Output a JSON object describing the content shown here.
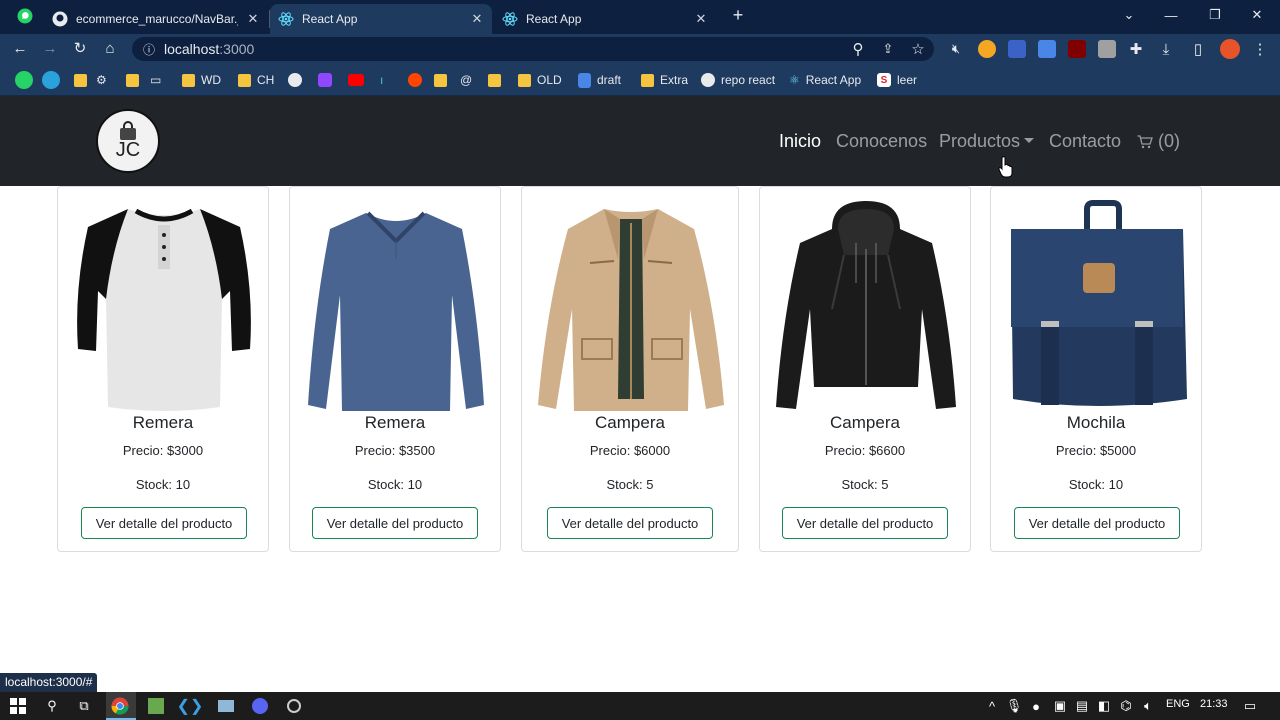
{
  "browser": {
    "tabs": [
      {
        "title": "ecommerce_marucco/NavBar.js a",
        "icon": "github-icon"
      },
      {
        "title": "React App",
        "icon": "react-icon"
      },
      {
        "title": "React App",
        "icon": "react-icon"
      }
    ],
    "url_host": "localhost",
    "url_port": ":3000",
    "bookmarks": [
      "WD",
      "CH",
      "OLD",
      "draft",
      "Extra",
      "repo react",
      "React App",
      "leer"
    ]
  },
  "navbar": {
    "logo_text": "JC",
    "links": {
      "inicio": "Inicio",
      "conocenos": "Conocenos",
      "productos": "Productos",
      "contacto": "Contacto"
    },
    "cart_count": "(0)"
  },
  "products": [
    {
      "name": "Remera",
      "price": "Precio: $3000",
      "stock": "Stock: 10",
      "button": "Ver detalle del producto",
      "image": "raglan-tshirt"
    },
    {
      "name": "Remera",
      "price": "Precio: $3500",
      "stock": "Stock: 10",
      "button": "Ver detalle del producto",
      "image": "blue-longsleeve"
    },
    {
      "name": "Campera",
      "price": "Precio: $6000",
      "stock": "Stock: 5",
      "button": "Ver detalle del producto",
      "image": "beige-field-jacket"
    },
    {
      "name": "Campera",
      "price": "Precio: $6600",
      "stock": "Stock: 5",
      "button": "Ver detalle del producto",
      "image": "black-leather-jacket"
    },
    {
      "name": "Mochila",
      "price": "Precio: $5000",
      "stock": "Stock: 10",
      "button": "Ver detalle del producto",
      "image": "navy-backpack"
    }
  ],
  "status_url": "localhost:3000/#",
  "taskbar": {
    "lang": "ENG",
    "time": "21:33"
  },
  "colors": {
    "navbar_bg": "#212529",
    "button_border": "#198754",
    "browser_frame": "#0d2040"
  }
}
